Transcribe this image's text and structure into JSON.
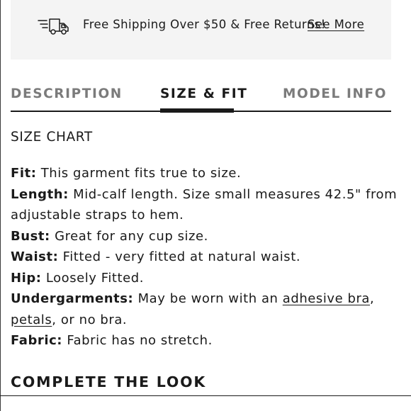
{
  "banner": {
    "icon": "shipping-truck-icon",
    "text": "Free Shipping Over $50 & Free Returns!",
    "link": "See More"
  },
  "tabs": [
    {
      "label": "DESCRIPTION",
      "active": false
    },
    {
      "label": "SIZE & FIT",
      "active": true
    },
    {
      "label": "MODEL INFO",
      "active": false
    }
  ],
  "size_chart_label": "SIZE CHART",
  "fit_details": {
    "fit": {
      "label": "Fit:",
      "value": "This garment fits true to size."
    },
    "length": {
      "label": "Length:",
      "value_line1": "Mid-calf length. Size small measures 42.5\" from",
      "value_line2": "adjustable straps to hem."
    },
    "bust": {
      "label": "Bust:",
      "value": "Great for any cup size."
    },
    "waist": {
      "label": "Waist:",
      "value": "Fitted - very fitted at natural waist."
    },
    "hip": {
      "label": "Hip:",
      "value": "Loosely Fitted."
    },
    "undergarments": {
      "label": "Undergarments:",
      "prefix": "May be worn with an",
      "link1": "adhesive bra",
      "sep": ",",
      "link2": "petals",
      "suffix": ", or no bra."
    },
    "fabric": {
      "label": "Fabric:",
      "value": "Fabric has no stretch."
    }
  },
  "complete_the_look": "COMPLETE THE LOOK",
  "colors": {
    "text": "#1a1a1a",
    "inactive_tab": "#7b7b7b",
    "banner_bg": "#f4f4f4"
  }
}
